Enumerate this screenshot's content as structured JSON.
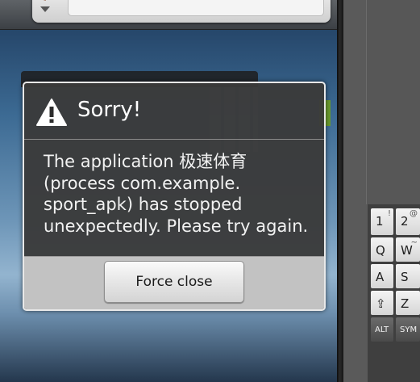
{
  "dialog": {
    "title": "Sorry!",
    "message": "The application 极速体育 (process com.example. sport_apk) has stopped unexpectedly. Please try again.",
    "button_label": "Force close",
    "icon": "warning-icon"
  },
  "keyboard": {
    "keys": [
      {
        "main": "1",
        "sub": "!"
      },
      {
        "main": "2",
        "sub": "@"
      },
      {
        "main": "Q",
        "sub": ""
      },
      {
        "main": "W",
        "sub": "~"
      },
      {
        "main": "A",
        "sub": ""
      },
      {
        "main": "S",
        "sub": ""
      },
      {
        "main": "⇪",
        "sub": ""
      },
      {
        "main": "Z",
        "sub": ""
      },
      {
        "main": "ALT",
        "sub": ""
      },
      {
        "main": "SYM",
        "sub": ""
      }
    ]
  },
  "colors": {
    "dialog_bg": "#3a3a3a",
    "dialog_footer": "#c2c2c2",
    "dialog_border": "#e8e8e8"
  }
}
